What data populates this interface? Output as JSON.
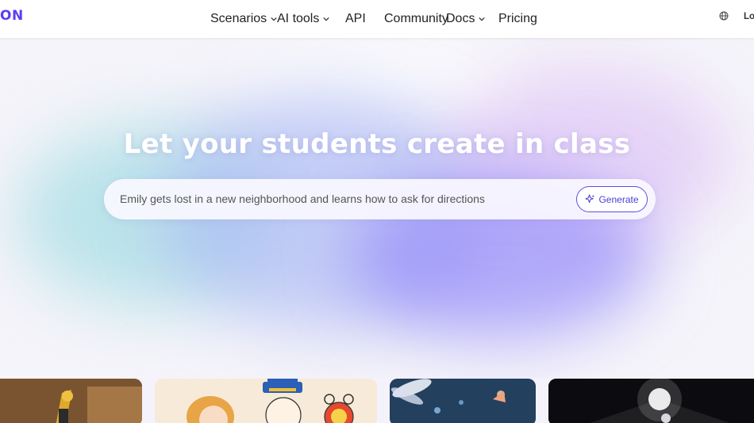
{
  "header": {
    "logo": "ON",
    "nav": [
      {
        "label": "Scenarios",
        "has_dropdown": true
      },
      {
        "label": "AI tools",
        "has_dropdown": true
      },
      {
        "label": "API",
        "has_dropdown": false
      },
      {
        "label": "Community",
        "has_dropdown": false
      },
      {
        "label": "Docs",
        "has_dropdown": true
      },
      {
        "label": "Pricing",
        "has_dropdown": false
      }
    ],
    "language_icon": "globe-icon",
    "login": "Lo"
  },
  "hero": {
    "title": "Let your students create in class",
    "prompt_value": "Emily gets lost in a new neighborhood and learns how to ask for directions",
    "generate_label": "Generate",
    "generate_icon": "sparkle-icon"
  },
  "colors": {
    "brand": "#5b3df5",
    "button_border": "#5b4fe0",
    "background": "#f4f3fb"
  }
}
